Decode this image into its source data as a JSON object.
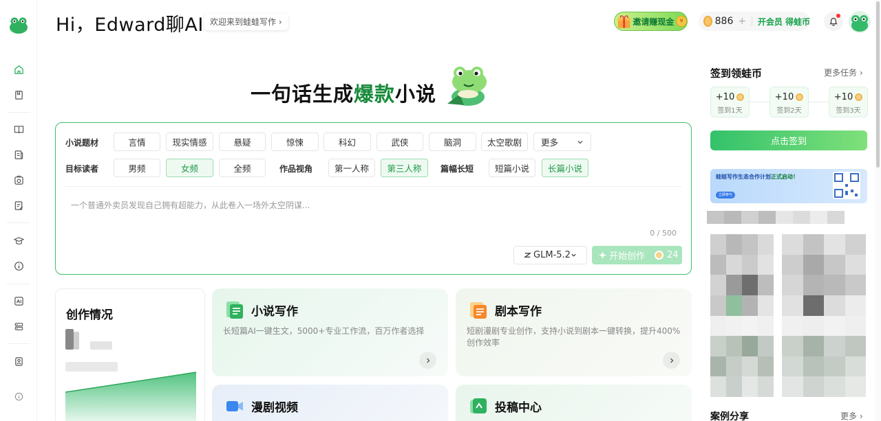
{
  "header": {
    "greeting": "Hi，Edward聊AI",
    "welcome": "欢迎来到蛙蛙写作 ›",
    "invite_label": "邀请赚现金",
    "coin_balance": "886",
    "plus": "+",
    "vip_label": "开会员 得蛙币"
  },
  "hero": {
    "title_before": "一句话生成",
    "title_highlight": "爆款",
    "title_after": "小说"
  },
  "form": {
    "genre_label": "小说题材",
    "genres": [
      "言情",
      "现实情感",
      "悬疑",
      "惊悚",
      "科幻",
      "武侠",
      "脑洞",
      "太空歌剧"
    ],
    "more_label": "更多",
    "reader_label": "目标读者",
    "readers": [
      "男频",
      "女频",
      "全频"
    ],
    "reader_selected": "女频",
    "pov_label": "作品视角",
    "povs": [
      "第一人称",
      "第三人称"
    ],
    "pov_selected": "第三人称",
    "length_label": "篇幅长短",
    "lengths": [
      "短篇小说",
      "长篇小说"
    ],
    "length_selected": "长篇小说",
    "prompt_placeholder": "一个普通外卖员发现自己拥有超能力，从此卷入一场外太空阴谋...",
    "char_count": "0 / 500",
    "model": "GLM-5.2",
    "start_label": "开始创作",
    "cost": "24"
  },
  "cards": {
    "creation_title": "创作情况",
    "novel_title": "小说写作",
    "novel_desc": "长短篇AI一键生文，5000+专业工作流，百万作者选择",
    "script_title": "剧本写作",
    "script_desc": "短剧漫剧专业创作，支持小说到剧本一键转换，提升400%创作效率",
    "video_title": "漫剧视频",
    "submit_title": "投稿中心"
  },
  "right": {
    "checkin_title": "签到领蛙币",
    "more_tasks": "更多任务 ›",
    "days": [
      {
        "amount": "+10",
        "label": "签到1天"
      },
      {
        "amount": "+10",
        "label": "签到2天"
      },
      {
        "amount": "+10",
        "label": "签到3天"
      }
    ],
    "checkin_button": "点击签到",
    "banner_text_1": "蛙蛙写作生态合作计划",
    "banner_text_2": "正式启动！",
    "banner_button": "立即参与",
    "cases_title": "案例分享",
    "cases_more": "更多 ›"
  },
  "colors": {
    "accent": "#1f9a4a",
    "selected_bg": "#eefaf1",
    "prompt_border": "#3cbf6e",
    "start_button": "#a9e5bd"
  }
}
